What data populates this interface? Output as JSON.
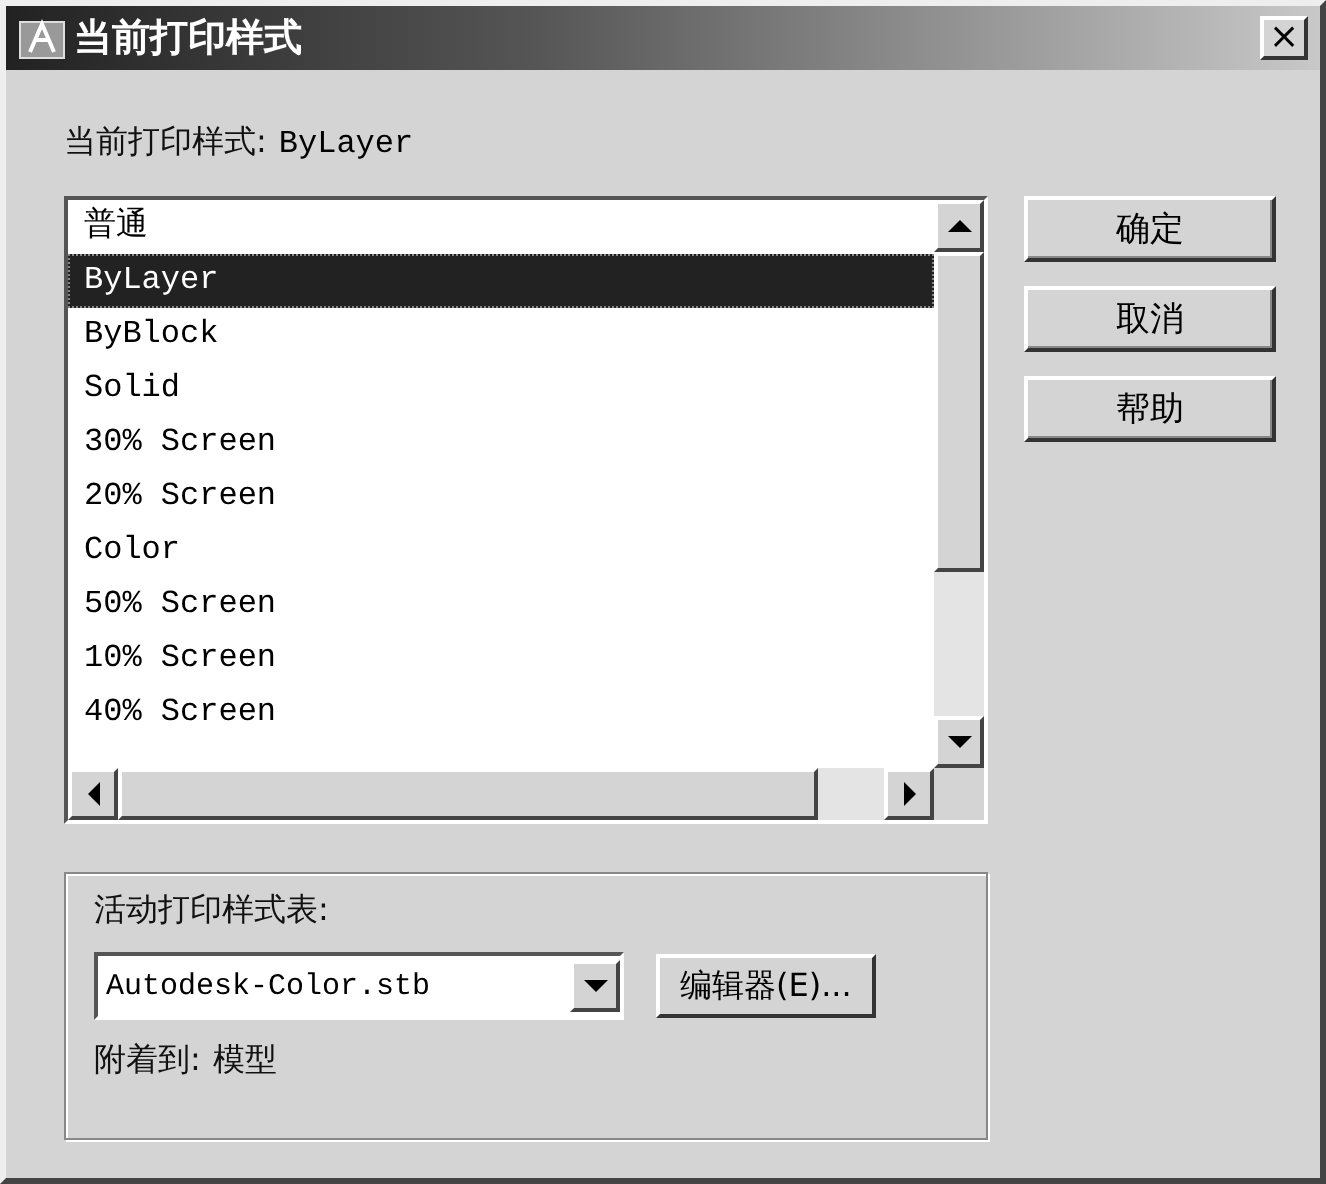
{
  "window": {
    "title": "当前打印样式",
    "close": "×"
  },
  "current_style": {
    "label": "当前打印样式:",
    "value": "ByLayer"
  },
  "styles": [
    {
      "label": "普通",
      "selected": false
    },
    {
      "label": "ByLayer",
      "selected": true
    },
    {
      "label": "ByBlock",
      "selected": false
    },
    {
      "label": "Solid",
      "selected": false
    },
    {
      "label": "30% Screen",
      "selected": false
    },
    {
      "label": "20% Screen",
      "selected": false
    },
    {
      "label": "Color",
      "selected": false
    },
    {
      "label": "50% Screen",
      "selected": false
    },
    {
      "label": "10% Screen",
      "selected": false
    },
    {
      "label": "40% Screen",
      "selected": false
    }
  ],
  "buttons": [
    "确定",
    "取消",
    "帮助"
  ],
  "active_table": {
    "label": "活动打印样式表:",
    "value": "Autodesk-Color.stb",
    "editor_button": "编辑器(E)...",
    "attached_label": "附着到:",
    "attached_value": "模型"
  }
}
